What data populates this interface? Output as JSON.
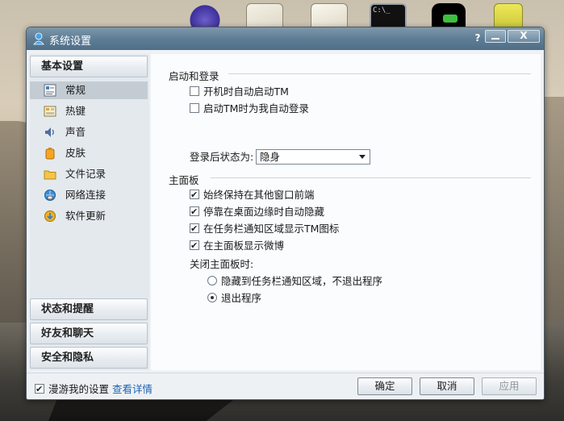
{
  "window": {
    "title": "系统设置",
    "help_label": "?",
    "close_label": "X"
  },
  "sidebar": {
    "sections": {
      "basic": "基本设置",
      "status": "状态和提醒",
      "friends": "好友和聊天",
      "security": "安全和隐私"
    },
    "items": [
      {
        "label": "常规",
        "icon": "settings-icon",
        "active": true
      },
      {
        "label": "热键",
        "icon": "keyboard-icon"
      },
      {
        "label": "声音",
        "icon": "speaker-icon"
      },
      {
        "label": "皮肤",
        "icon": "skin-icon"
      },
      {
        "label": "文件记录",
        "icon": "folder-icon"
      },
      {
        "label": "网络连接",
        "icon": "network-icon"
      },
      {
        "label": "软件更新",
        "icon": "update-icon"
      }
    ]
  },
  "content": {
    "startup_group": "启动和登录",
    "auto_start": {
      "label": "开机时自动启动TM",
      "checked": false
    },
    "auto_login": {
      "label": "启动TM时为我自动登录",
      "checked": false
    },
    "login_status_label": "登录后状态为:",
    "login_status_value": "隐身",
    "panel_group": "主面板",
    "always_on_top": {
      "label": "始终保持在其他窗口前端",
      "checked": true
    },
    "auto_hide": {
      "label": "停靠在桌面边缘时自动隐藏",
      "checked": true
    },
    "tray_icon": {
      "label": "在任务栏通知区域显示TM图标",
      "checked": true
    },
    "show_weibo": {
      "label": "在主面板显示微博",
      "checked": true
    },
    "close_label": "关闭主面板时:",
    "close_hide": {
      "label": "隐藏到任务栏通知区域，不退出程序",
      "checked": false
    },
    "close_exit": {
      "label": "退出程序",
      "checked": true
    }
  },
  "footer": {
    "roam_label": "漫游我的设置",
    "roam_checked": true,
    "details_link": "查看详情",
    "ok_label": "确定",
    "cancel_label": "取消",
    "apply_label": "应用"
  },
  "colors": {
    "titlebar": "#5f7e96",
    "link": "#1b64b4",
    "active_item": "#c4ccd3"
  }
}
